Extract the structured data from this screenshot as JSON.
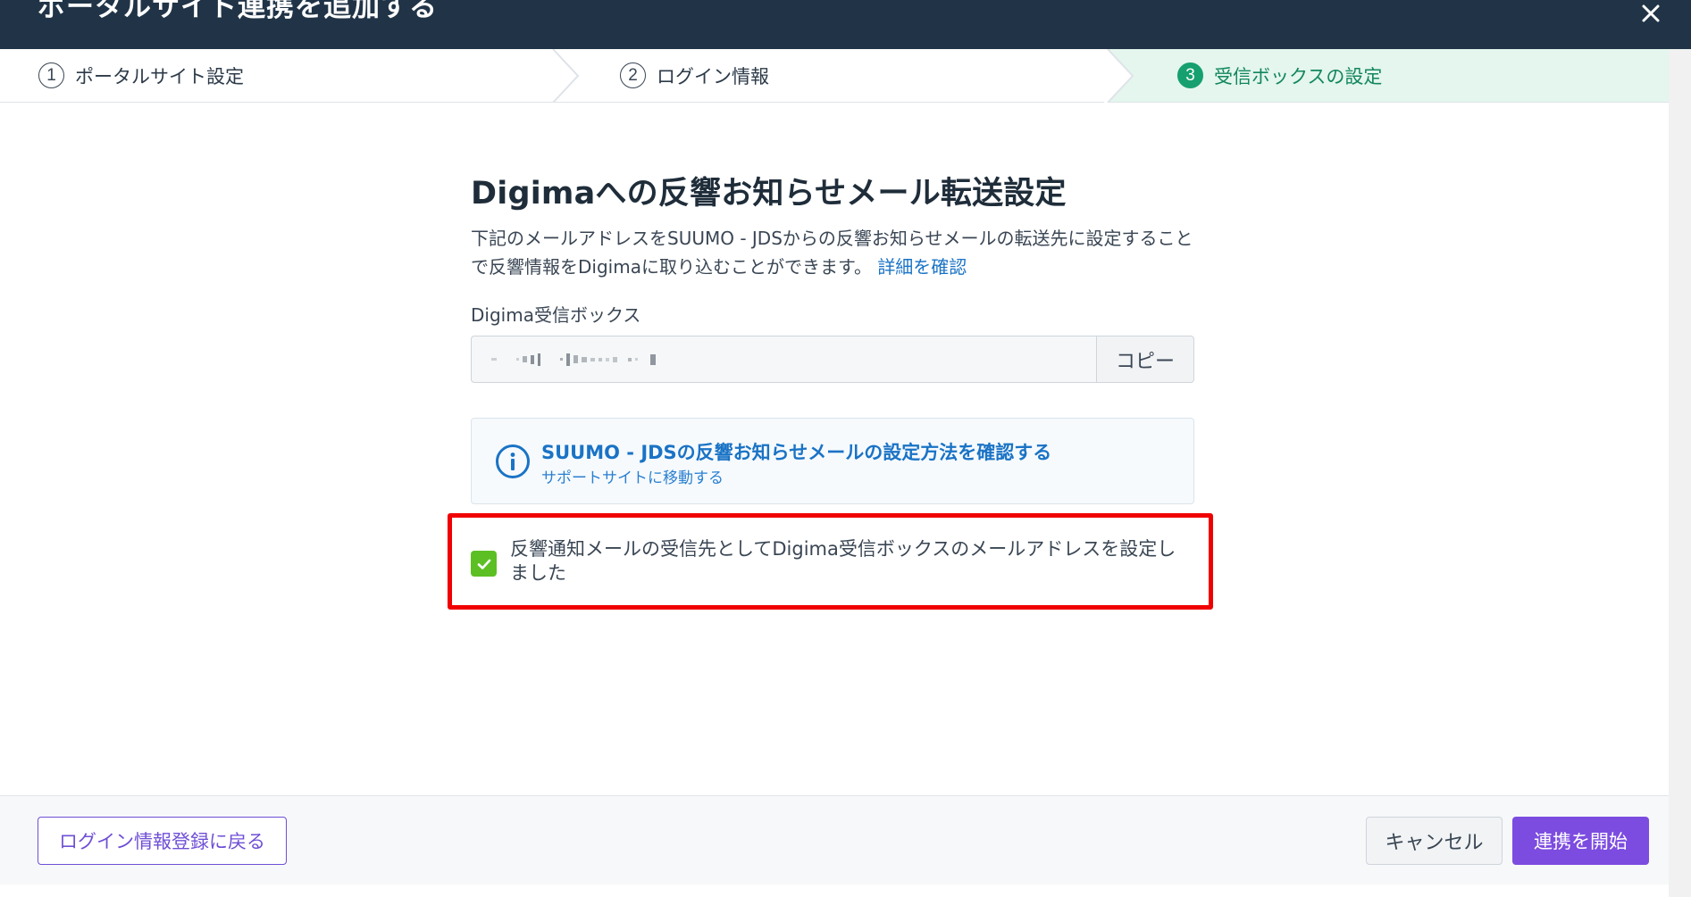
{
  "header": {
    "title": "ポータルサイト連携を追加する"
  },
  "stepper": {
    "steps": [
      {
        "num": "1",
        "label": "ポータルサイト設定"
      },
      {
        "num": "2",
        "label": "ログイン情報"
      },
      {
        "num": "3",
        "label": "受信ボックスの設定"
      }
    ],
    "active_step": 3
  },
  "content": {
    "title": "Digimaへの反響お知らせメール転送設定",
    "description": "下記のメールアドレスをSUUMO - JDSからの反響お知らせメールの転送先に設定することで反響情報をDigimaに取り込むことができます。",
    "details_link": "詳細を確認",
    "inbox_label": "Digima受信ボックス",
    "copy_button": "コピー",
    "help_title": "SUUMO - JDSの反響お知らせメールの設定方法を確認する",
    "help_subtitle": "サポートサイトに移動する",
    "checkbox_label": "反響通知メールの受信先としてDigima受信ボックスのメールアドレスを設定しました",
    "checkbox_checked": true
  },
  "footer": {
    "back_button": "ログイン情報登録に戻る",
    "cancel_button": "キャンセル",
    "start_button": "連携を開始"
  },
  "colors": {
    "header_bg": "#213447",
    "accent_purple": "#7c4ce0",
    "active_step_green": "#16a06f",
    "link_blue": "#1a73c5",
    "checkbox_green": "#5cc024",
    "highlight_red": "#f00000"
  },
  "icons": {
    "close": "close-icon",
    "info": "info-icon",
    "check": "check-icon"
  }
}
